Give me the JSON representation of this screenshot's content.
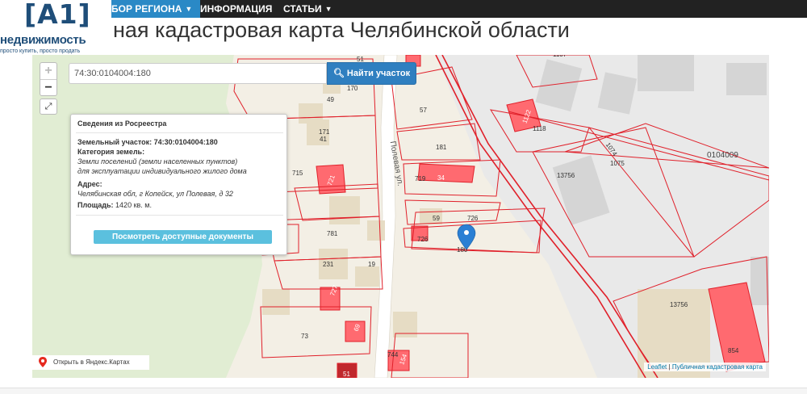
{
  "nav": {
    "items": [
      {
        "label": "БОР РЕГИОНА"
      },
      {
        "label": "ИНФОРМАЦИЯ"
      },
      {
        "label": "СТАТЬИ"
      }
    ]
  },
  "logo": {
    "mark": "[A1]",
    "name": "недвижимость",
    "tagline": "просто купить, просто продать"
  },
  "page_title": "ная кадастровая карта Челябинской области",
  "search": {
    "value": "74:30:0104004:180",
    "button_label": "Найти участок"
  },
  "zoom": {
    "in": "+",
    "out": "−"
  },
  "info_panel": {
    "title": "Сведения из Росреестра",
    "parcel_label": "Земельный участок:",
    "parcel_value": "74:30:0104004:180",
    "category_label": "Категория земель:",
    "category_line1": "Земли поселений (земли населенных пунктов)",
    "category_line2": "для эксплуатации индивидуального жилого дома",
    "address_label": "Адрес:",
    "address_value": "Челябинская обл, г Копейск, ул Полевая, д 32",
    "area_label": "Площадь:",
    "area_value": "1420 кв. м.",
    "docs_button": "Посмотреть доступные документы"
  },
  "map": {
    "street_name": "Полевая ул.",
    "quarter_label": "0104009",
    "labels": [
      "51",
      "170",
      "49",
      "171",
      "41",
      "715",
      "721",
      "781",
      "231",
      "19",
      "726",
      "73",
      "727",
      "69",
      "742",
      "51",
      "744",
      "154",
      "57",
      "181",
      "719",
      "34",
      "59",
      "726",
      "180",
      "1122",
      "1118",
      "1074",
      "1075",
      "13756",
      "13756",
      "854",
      "1107"
    ],
    "colors": {
      "parcel_stroke": "#e0202a",
      "parcel_fill": "#ff6a70",
      "land": "#f3efe5",
      "building": "#e6dcc4",
      "road": "#ffffff",
      "grey_building": "#d5d5d5",
      "green": "#e1edd3"
    }
  },
  "attribution": {
    "yandex": "Открыть в Яндекс.Картах",
    "leaflet": "Leaflet",
    "separator": " | ",
    "source": "Публичная кадастровая карта"
  }
}
